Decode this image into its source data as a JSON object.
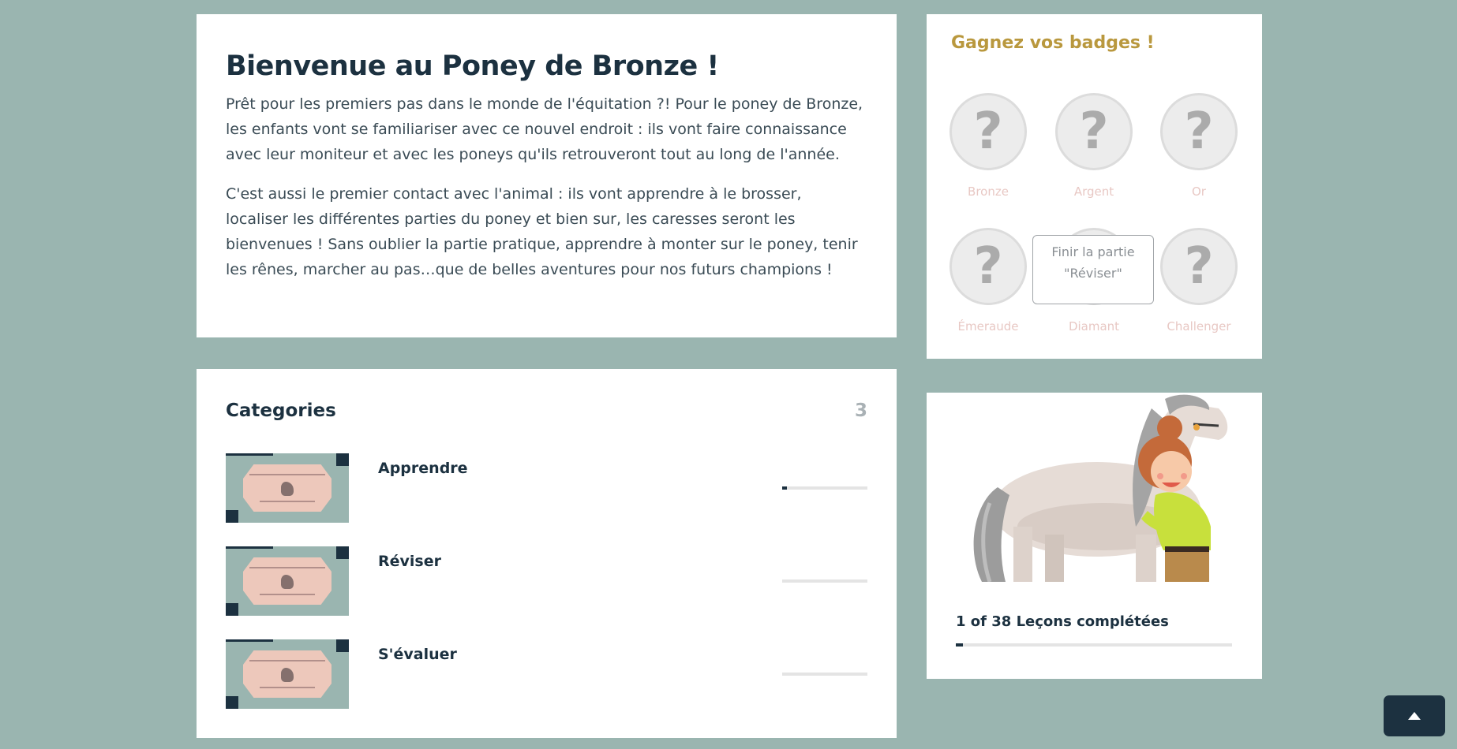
{
  "welcome": {
    "title": "Bienvenue au Poney de Bronze !",
    "paragraph1": "Prêt pour les premiers pas dans le monde de l'équitation ?! Pour le poney de Bronze, les enfants vont se familiariser avec ce nouvel endroit : ils vont faire connaissance avec leur moniteur et avec les poneys qu'ils retrouveront tout au long de l'année.",
    "paragraph2": "C'est aussi le premier contact avec l'animal : ils vont apprendre à le brosser, localiser les différentes parties du poney et bien sur, les caresses seront les bienvenues ! Sans oublier la partie pratique, apprendre à monter sur le poney, tenir les rênes, marcher au pas…que de belles aventures pour nos futurs champions !"
  },
  "categories": {
    "title": "Categories",
    "count": "3",
    "items": [
      {
        "name": "Apprendre",
        "progress": 0.06
      },
      {
        "name": "Réviser",
        "progress": 0.0
      },
      {
        "name": "S'évaluer",
        "progress": 0.0
      }
    ]
  },
  "badges": {
    "title": "Gagnez vos badges !",
    "items": [
      {
        "label": "Bronze",
        "icon": "question-mark-icon"
      },
      {
        "label": "Argent",
        "icon": "question-mark-icon"
      },
      {
        "label": "Or",
        "icon": "question-mark-icon"
      },
      {
        "label": "Émeraude",
        "icon": "question-mark-icon"
      },
      {
        "label": "Diamant",
        "icon": "question-mark-icon"
      },
      {
        "label": "Challenger",
        "icon": "question-mark-icon"
      }
    ],
    "symbol": "?",
    "tooltip": "Finir la partie \"Réviser\""
  },
  "lessons": {
    "text": "1 of 38 Leçons complétées",
    "progress": 0.026
  },
  "colors": {
    "background": "#9ab5b0",
    "primary": "#1c3140",
    "badge_title": "#b9983e",
    "badge_label": "#e8c8c4"
  },
  "back_to_top": {
    "icon": "chevron-up-icon"
  }
}
